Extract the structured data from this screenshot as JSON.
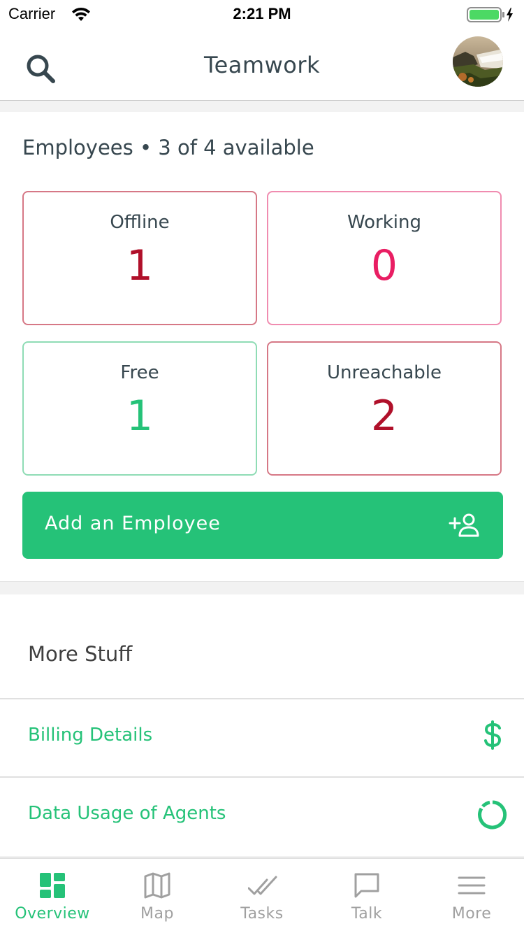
{
  "status_bar": {
    "carrier": "Carrier",
    "time": "2:21 PM"
  },
  "header": {
    "title": "Teamwork"
  },
  "employees": {
    "heading": "Employees • 3 of 4 available",
    "stats": [
      {
        "label": "Offline",
        "value": "1",
        "color": "#b0102a",
        "border": "#d67886"
      },
      {
        "label": "Working",
        "value": "0",
        "color": "#e91e63",
        "border": "#f08cb0"
      },
      {
        "label": "Free",
        "value": "1",
        "color": "#25c278",
        "border": "#8fdcb5"
      },
      {
        "label": "Unreachable",
        "value": "2",
        "color": "#b0102a",
        "border": "#d67886"
      }
    ],
    "add_button": "Add an Employee"
  },
  "more": {
    "heading": "More Stuff",
    "items": [
      {
        "label": "Billing Details",
        "icon": "dollar-icon"
      },
      {
        "label": "Data Usage of Agents",
        "icon": "donut-chart-icon"
      }
    ]
  },
  "tabs": [
    {
      "label": "Overview",
      "icon": "dashboard-icon",
      "active": true
    },
    {
      "label": "Map",
      "icon": "map-icon",
      "active": false
    },
    {
      "label": "Tasks",
      "icon": "double-check-icon",
      "active": false
    },
    {
      "label": "Talk",
      "icon": "chat-bubble-icon",
      "active": false
    },
    {
      "label": "More",
      "icon": "menu-icon",
      "active": false
    }
  ],
  "colors": {
    "accent": "#25c278",
    "text": "#37474f",
    "alert": "#b0102a",
    "working": "#e91e63"
  }
}
